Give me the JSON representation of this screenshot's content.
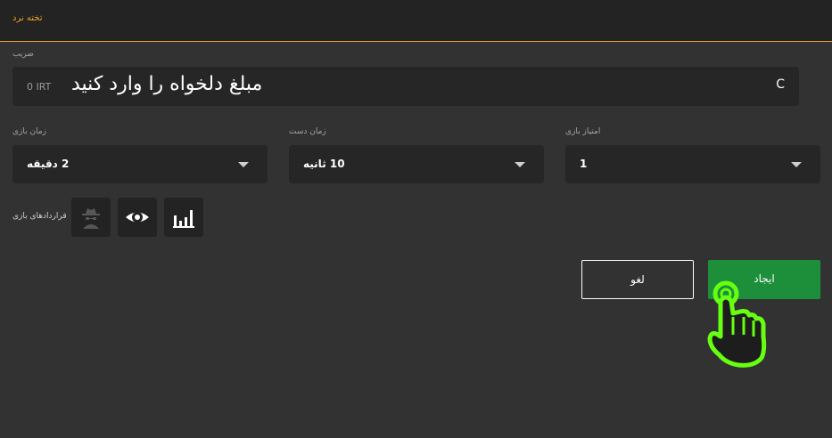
{
  "header": {
    "title": "تخته نرد"
  },
  "stake": {
    "label": "ضریب",
    "currency": "0 IRT",
    "placeholder": "مبلغ دلخواه را وارد کنید",
    "clear_label": "C"
  },
  "selects": {
    "game_time": {
      "label": "زمان بازی",
      "value": "2 دقیقه"
    },
    "hand_time": {
      "label": "زمان دست",
      "value": "10 ثانیه"
    },
    "points": {
      "label": "امتیاز بازی",
      "value": "1"
    }
  },
  "contract": {
    "label": "قراردادهای بازی",
    "icons": [
      "spy-icon",
      "eye-icon",
      "bar-chart-icon"
    ]
  },
  "actions": {
    "cancel_label": "لغو",
    "create_label": "ایجاد"
  },
  "colors": {
    "accent": "#f0a326",
    "create_button": "#1d8f3a",
    "pointer_hand": "#66ff11",
    "background": "#323232",
    "panel": "#262626"
  }
}
